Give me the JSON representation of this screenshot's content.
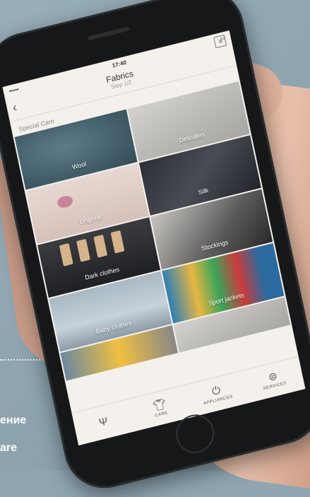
{
  "status": {
    "carrier": "•••••",
    "wifi": "wifi-icon",
    "time": "17:40"
  },
  "nav": {
    "title": "Fabrics",
    "subtitle": "Step 1/2"
  },
  "section_label": "Special Care",
  "tiles": [
    {
      "label": "Wool"
    },
    {
      "label": "Delicates"
    },
    {
      "label": "Lingerie"
    },
    {
      "label": "Silk"
    },
    {
      "label": "Dark clothes"
    },
    {
      "label": "Stockings"
    },
    {
      "label": "Baby clothes"
    },
    {
      "label": "Sport jackets"
    },
    {
      "label": ""
    },
    {
      "label": ""
    }
  ],
  "tabbar": [
    {
      "icon": "fork-knife-icon",
      "label": ""
    },
    {
      "icon": "shirt-icon",
      "label": "CARE"
    },
    {
      "icon": "power-icon",
      "label": "APPLIANCES"
    },
    {
      "icon": "services-icon",
      "label": "SERVICES"
    }
  ],
  "background_text": {
    "line1": "ение",
    "line2": "are"
  }
}
